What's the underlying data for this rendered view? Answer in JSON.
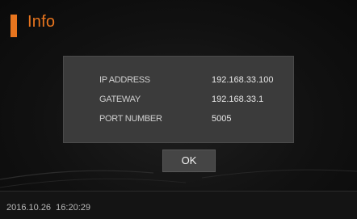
{
  "header": {
    "title": "Info",
    "accent_color": "#e8751e"
  },
  "info_panel": {
    "rows": [
      {
        "label": "IP ADDRESS",
        "value": "192.168.33.100"
      },
      {
        "label": "GATEWAY",
        "value": "192.168.33.1"
      },
      {
        "label": "PORT NUMBER",
        "value": "5005"
      }
    ]
  },
  "actions": {
    "ok_label": "OK"
  },
  "footer": {
    "datetime": "2016.10.26  16:20:29"
  }
}
